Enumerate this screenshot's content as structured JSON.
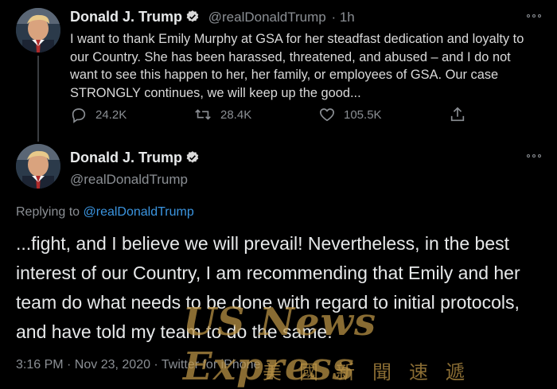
{
  "colors": {
    "background": "#000000",
    "text": "#e7e9ea",
    "muted": "#8b8f94",
    "link": "#3b95e0",
    "verified": "#d9d9d9"
  },
  "tweet1": {
    "name": "Donald J. Trump",
    "handle": "@realDonaldTrump",
    "time": "· 1h",
    "text": "I want to thank Emily Murphy at GSA for her steadfast dedication and loyalty to our Country. She has been harassed, threatened, and abused – and I do not want to see this happen to her, her family, or employees of GSA. Our case STRONGLY continues, we will keep up the good...",
    "actions": {
      "replies": "24.2K",
      "retweets": "28.4K",
      "likes": "105.5K"
    },
    "icons": [
      "reply-icon",
      "retweet-icon",
      "like-icon",
      "share-icon",
      "more-icon",
      "verified-icon"
    ]
  },
  "tweet2": {
    "name": "Donald J. Trump",
    "handle": "@realDonaldTrump",
    "replying_prefix": "Replying to",
    "replying_to": "@realDonaldTrump",
    "text": "...fight, and I believe we will prevail! Nevertheless, in the best interest of our Country, I am recommending that Emily and her team do what needs to be done with regard to initial protocols, and have told my team to do the same.",
    "timestamp": "3:16 PM · Nov 23, 2020 · Twitter for iPhone"
  },
  "watermark": {
    "text": "US News Express",
    "cn": "美國新聞速遞"
  }
}
